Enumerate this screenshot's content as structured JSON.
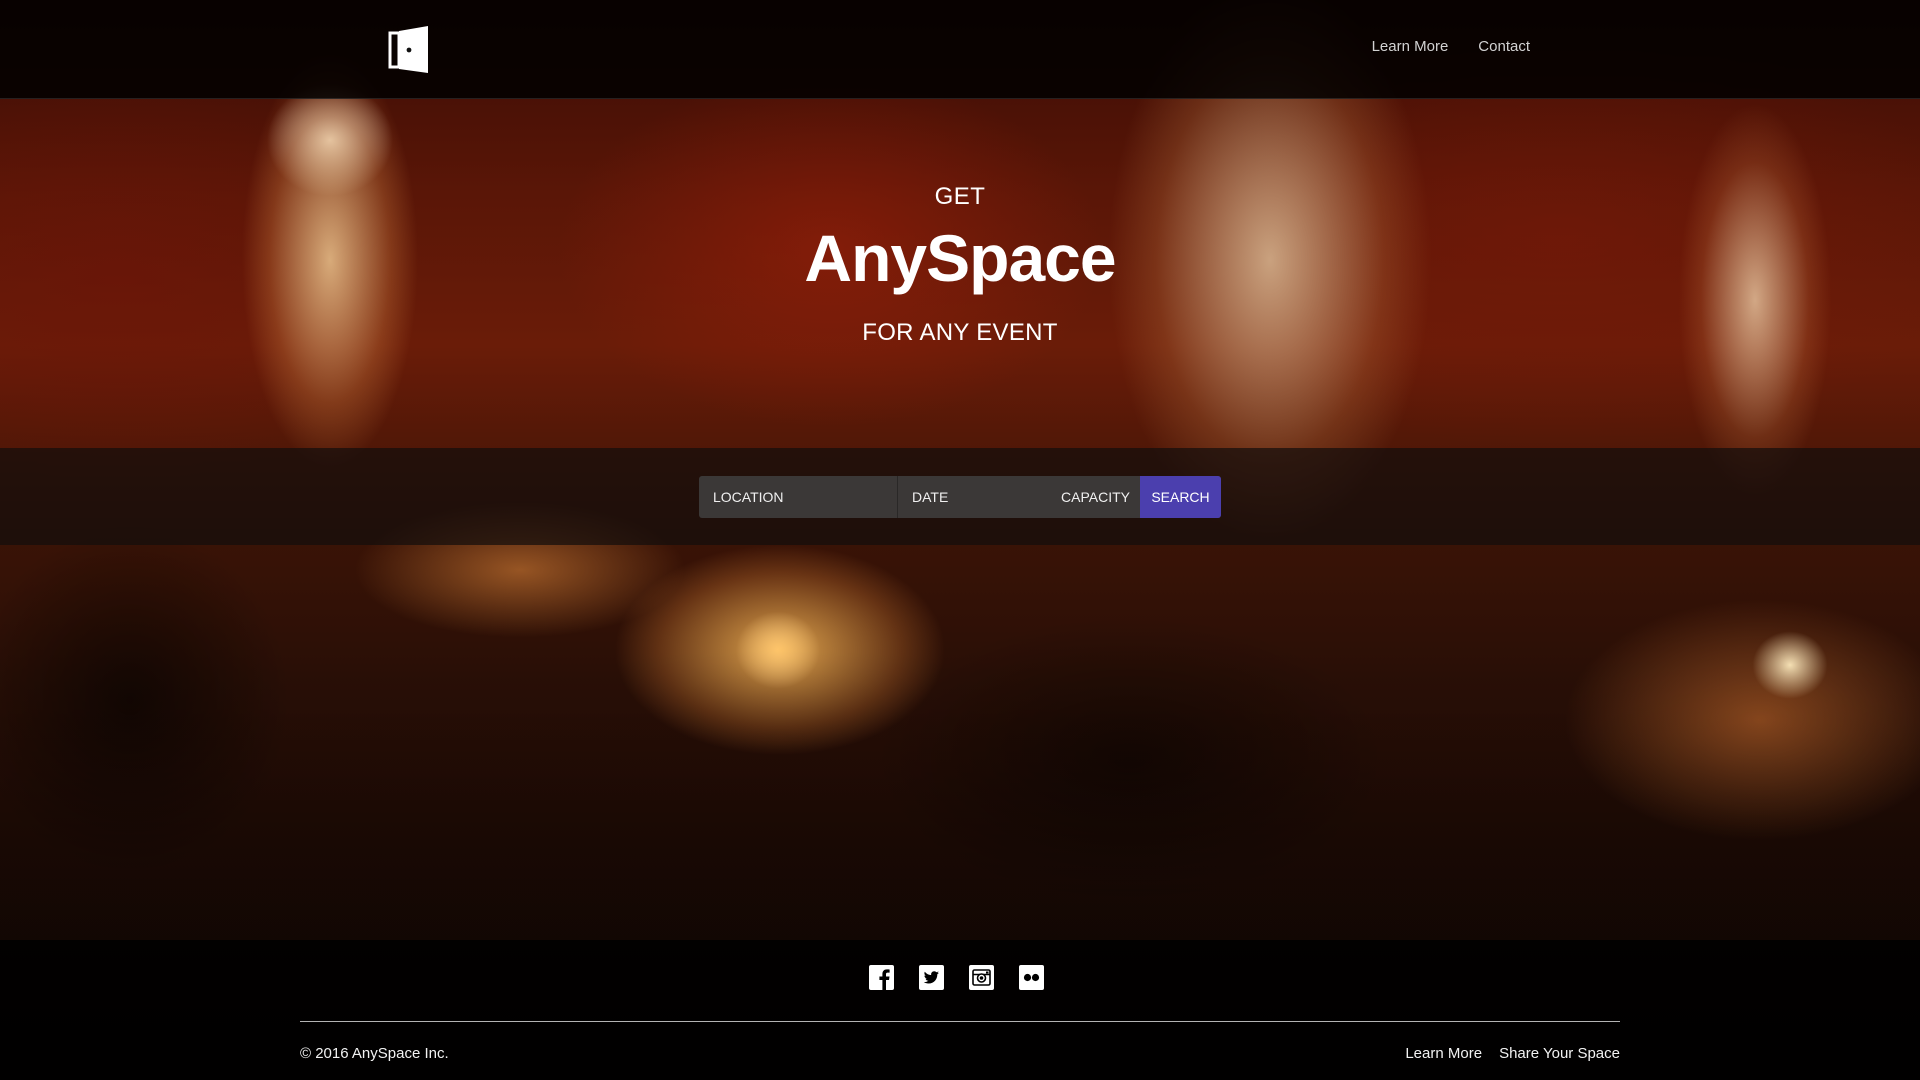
{
  "header": {
    "logo_icon": "door-icon",
    "nav": [
      {
        "label": "Learn More"
      },
      {
        "label": "Contact"
      }
    ]
  },
  "hero": {
    "get": "GET",
    "brand": "AnySpace",
    "subtitle": "FOR ANY EVENT"
  },
  "search": {
    "location_label": "LOCATION",
    "date_label": "DATE",
    "capacity_label": "CAPACITY",
    "button_label": "SEARCH",
    "button_color": "#4b3fae"
  },
  "footer": {
    "socials": [
      "facebook-icon",
      "twitter-icon",
      "instagram-icon",
      "flickr-icon"
    ],
    "copyright": "© 2016 AnySpace Inc.",
    "links": [
      {
        "label": "Learn More"
      },
      {
        "label": "Share Your Space"
      }
    ]
  }
}
